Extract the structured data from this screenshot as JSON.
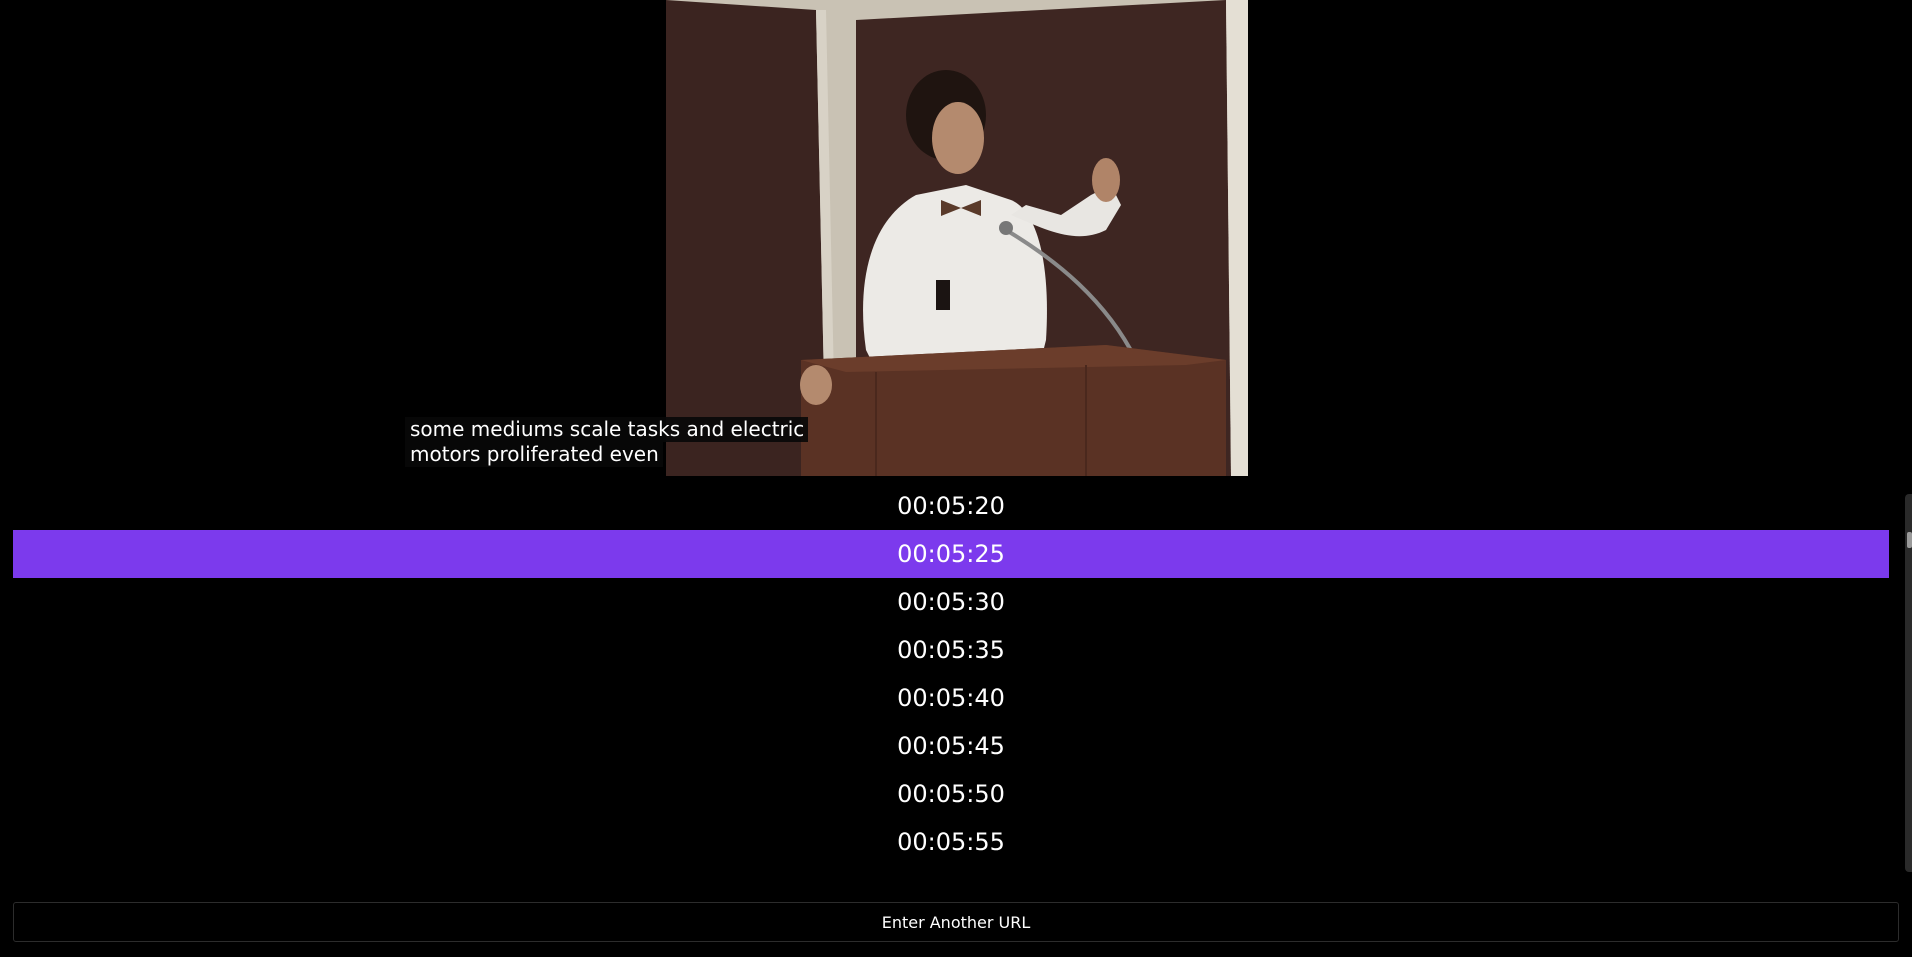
{
  "video": {
    "caption_lines": [
      "some mediums scale tasks and electric",
      "motors proliferated even"
    ]
  },
  "timestamps": {
    "items": [
      "00:05:20",
      "00:05:25",
      "00:05:30",
      "00:05:35",
      "00:05:40",
      "00:05:45",
      "00:05:50",
      "00:05:55"
    ],
    "active": "00:05:25",
    "active_color": "#7c3aed"
  },
  "actions": {
    "another_url_label": "Enter Another URL"
  }
}
